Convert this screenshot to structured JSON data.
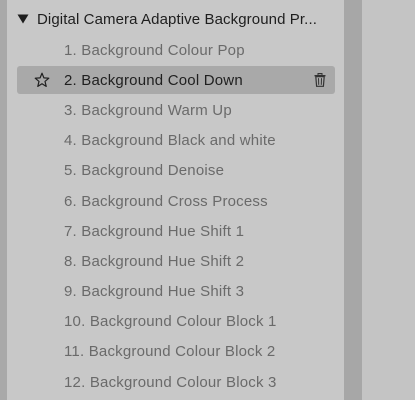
{
  "group": {
    "title": "Digital Camera Adaptive Background Pr...",
    "expanded": true,
    "disclosure_icon": "triangle-down-icon"
  },
  "presets": [
    {
      "label": "1. Background Colour Pop"
    },
    {
      "label": "2. Background Cool Down",
      "selected": true
    },
    {
      "label": "3. Background Warm Up"
    },
    {
      "label": "4. Background Black and white"
    },
    {
      "label": "5. Background Denoise"
    },
    {
      "label": "6. Background Cross Process"
    },
    {
      "label": "7. Background Hue Shift 1"
    },
    {
      "label": "8. Background Hue Shift 2"
    },
    {
      "label": "9. Background Hue Shift 3"
    },
    {
      "label": "10. Background Colour Block 1"
    },
    {
      "label": "11. Background Colour Block 2"
    },
    {
      "label": "12. Background Colour Block 3"
    }
  ],
  "selected_item_icons": [
    "star-outline-icon",
    "trash-icon"
  ],
  "colors": {
    "panel_bg": "#c8c8c8",
    "selected_bg": "#a9a9a9",
    "text_muted": "#6a6a6a",
    "text_strong": "#1f1f1f"
  }
}
